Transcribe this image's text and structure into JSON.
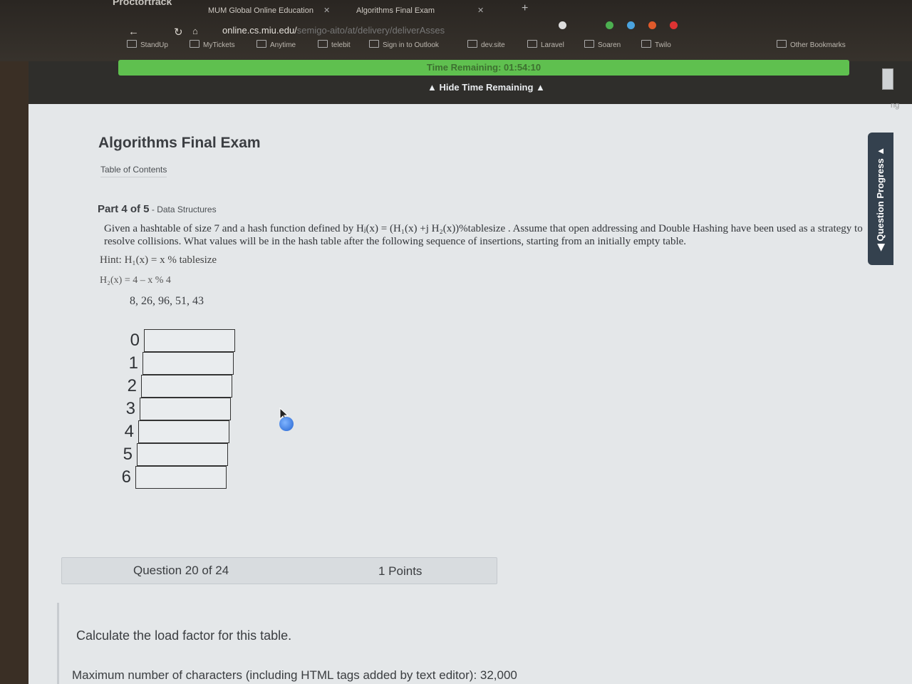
{
  "browser": {
    "proctor_label": "Proctortrack",
    "tabs": [
      {
        "label": "MUM Global Online Education",
        "close": "✕"
      },
      {
        "label": "Algorithms Final Exam",
        "close": "✕"
      }
    ],
    "new_tab": "+",
    "url_main": "online.cs.miu.edu/",
    "url_dim": "semigo-aito/at/delivery/deliverAsses",
    "bookmarks": [
      "StandUp",
      "MyTickets",
      "Anytime",
      "telebit",
      "Sign in to Outlook",
      "dev.site",
      "Laravel",
      "Soaren",
      "Twilo"
    ],
    "other_bookmarks": "Other Bookmarks"
  },
  "timer": {
    "remaining": "Time Remaining: 01:54:10",
    "hide_label": "▲ Hide Time Remaining ▲"
  },
  "exam": {
    "title": "Algorithms Final Exam",
    "toc": "Table of Contents",
    "part_prefix": "Part 4 of 5",
    "part_section": " - Data Structures",
    "question_text": "Given a hashtable of size 7 and a hash function defined by Hⱼ(x) = (H₁(x) +j H₂(x))%tablesize . Assume that open addressing and Double Hashing have been used as a strategy to resolve collisions. What values will be in the hash table after the following sequence of insertions, starting from an initially empty table.",
    "hint1": "Hint:  H₁(x) = x % tablesize",
    "hint2": "H₂(x) = 4 – x % 4",
    "sequence": "8, 26, 96, 51, 43",
    "table_indices": [
      "0",
      "1",
      "2",
      "3",
      "4",
      "5",
      "6"
    ],
    "question_number": "Question 20 of 24",
    "points": "1 Points",
    "load_question": "Calculate the load factor for this table.",
    "max_chars": "Maximum number of characters (including HTML tags added by text editor): 32,000",
    "progress_label": "◀ Question Progress ▲",
    "side_text": "ng"
  }
}
